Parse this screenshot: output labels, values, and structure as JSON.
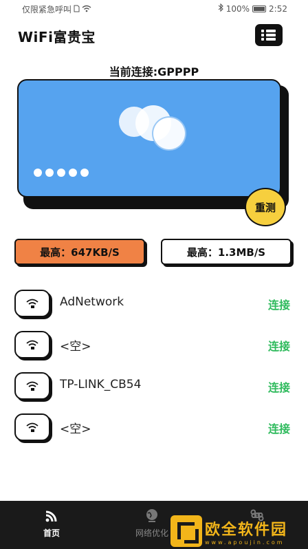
{
  "status_bar": {
    "left_text": "仅限紧急呼叫",
    "battery": "100%",
    "time": "2:52"
  },
  "header": {
    "title": "WiFi富贵宝",
    "menu_icon": "menu-grid-icon"
  },
  "connection": {
    "label": "当前连接:GPPPP"
  },
  "card": {
    "color": "#56a3ef",
    "dot_count": 5
  },
  "retest": {
    "label": "重测",
    "color": "#f6cf3e"
  },
  "speeds": {
    "upload_label": "最高：647KB/S",
    "download_label": "最高：1.3MB/S",
    "upload_color": "#f08245"
  },
  "wifi_list": [
    {
      "name": "AdNetwork",
      "action": "连接"
    },
    {
      "name": "<空>",
      "action": "连接"
    },
    {
      "name": "TP-LINK_CB54",
      "action": "连接"
    },
    {
      "name": "<空>",
      "action": "连接"
    }
  ],
  "accent_green": "#2eba5c",
  "bottom_nav": {
    "items": [
      {
        "label": "首页",
        "icon": "wifi-signal-icon",
        "active": true
      },
      {
        "label": "网络优化",
        "icon": "globe-icon",
        "active": false
      },
      {
        "label": "",
        "icon": "command-icon",
        "active": false
      }
    ]
  },
  "watermark": {
    "text": "欧全软件园",
    "url": "www.apoujin.com"
  }
}
